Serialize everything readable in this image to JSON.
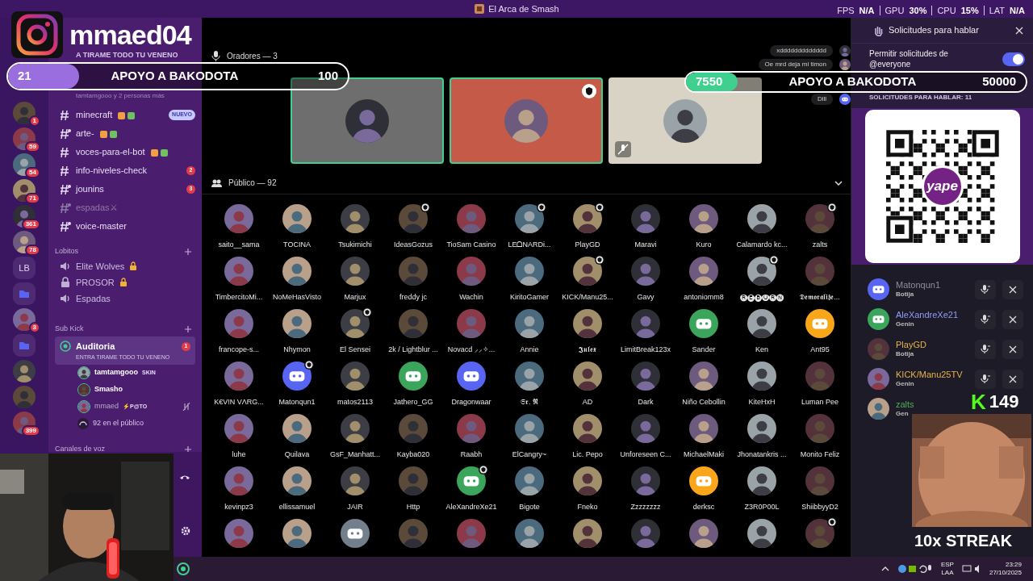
{
  "window": {
    "title": "El Arca de Smash"
  },
  "perf": [
    {
      "label": "FPS",
      "value": "N/A"
    },
    {
      "label": "GPU",
      "value": "30%"
    },
    {
      "label": "CPU",
      "value": "15%"
    },
    {
      "label": "LAT",
      "value": "N/A"
    }
  ],
  "servers": [
    {
      "kind": "picture",
      "badge": "1"
    },
    {
      "kind": "picture",
      "badge": "59"
    },
    {
      "kind": "picture",
      "badge": "54"
    },
    {
      "kind": "picture",
      "badge": "71"
    },
    {
      "kind": "picture",
      "badge": "361"
    },
    {
      "kind": "picture",
      "badge": "78"
    },
    {
      "kind": "initials",
      "text": "LB"
    },
    {
      "kind": "folder"
    },
    {
      "kind": "picture",
      "badge": "3"
    },
    {
      "kind": "folder"
    },
    {
      "kind": "picture"
    },
    {
      "kind": "picture"
    },
    {
      "kind": "picture",
      "badge": "399"
    }
  ],
  "channel_header": {
    "topic": "A TIRAME TODO TU VENENO",
    "listeners": "tamtamgooo y 2 personas más"
  },
  "channels": [
    {
      "name": "minecraft",
      "kind": "text",
      "muted": false,
      "tag": "NUEVO",
      "emoji": true
    },
    {
      "name": "arte-",
      "kind": "thread",
      "muted": false,
      "emoji": true
    },
    {
      "name": "voces-para-el-bot",
      "kind": "text",
      "muted": false,
      "emoji": true
    },
    {
      "name": "info-niveles-check",
      "kind": "text",
      "muted": false,
      "badge": "2"
    },
    {
      "name": "jounins",
      "kind": "thread",
      "muted": false,
      "badge": "3"
    },
    {
      "name": "espadas⚔",
      "kind": "thread",
      "muted": true
    },
    {
      "name": "voice-master",
      "kind": "thread",
      "muted": false
    }
  ],
  "categories": [
    {
      "name": "Lobitos",
      "channels": [
        {
          "name": "Elite Wolves",
          "kind": "voice",
          "locked": true
        },
        {
          "name": "PROSOR",
          "kind": "locked",
          "locked": true
        },
        {
          "name": "Espadas",
          "kind": "voice",
          "locked": false
        }
      ]
    },
    {
      "name": "Sub Kick",
      "channels": [
        {
          "name": "Auditoria",
          "kind": "stage",
          "locked": false,
          "badge": "1",
          "topic": "ENTRA TIRAME TODO TU VENENO",
          "members": [
            {
              "name": "tamtamgooo",
              "tag": "SKIN",
              "muted": false
            },
            {
              "name": "Smasho",
              "muted": false
            },
            {
              "name": "mmaed",
              "tag": "⚡P@TO",
              "muted": true
            }
          ],
          "audience": "92 en el público"
        }
      ]
    },
    {
      "name": "Canales de voz"
    }
  ],
  "stage": {
    "title": "Oradores — 3",
    "speakers": [
      {
        "color": "#6e6e6e",
        "speaking": true,
        "moderator": false,
        "muted": false
      },
      {
        "color": "#c65a48",
        "speaking": true,
        "moderator": true,
        "muted": false
      },
      {
        "color": "#d8d3c4",
        "speaking": false,
        "moderator": false,
        "muted": true
      }
    ]
  },
  "chat_bubbles": [
    {
      "text": "xddddddddddddd",
      "kind": "picture"
    },
    {
      "text": "Oe mrd deja mi timon",
      "kind": "picture"
    },
    {
      "text": "Dlll",
      "kind": "discord"
    }
  ],
  "audience": {
    "title": "Público — 92",
    "members": [
      {
        "name": "saito__sama",
        "kind": "picture",
        "badge": false
      },
      {
        "name": "TOCINA",
        "kind": "picture",
        "badge": false
      },
      {
        "name": "Tsukimichi",
        "kind": "picture",
        "badge": false
      },
      {
        "name": "IdeasGozus",
        "kind": "picture",
        "badge": true
      },
      {
        "name": "TioSam Casino",
        "kind": "picture",
        "badge": false
      },
      {
        "name": "LEᗝNARDi...",
        "kind": "picture",
        "badge": true
      },
      {
        "name": "PlayGD",
        "kind": "picture",
        "badge": true
      },
      {
        "name": "Maravi",
        "kind": "picture",
        "badge": false
      },
      {
        "name": "Kuro",
        "kind": "picture",
        "badge": false
      },
      {
        "name": "Calamardo kc...",
        "kind": "picture",
        "badge": false
      },
      {
        "name": "zalts",
        "kind": "picture",
        "badge": true
      },
      {
        "name": "TimbercitoMi...",
        "kind": "picture",
        "badge": false
      },
      {
        "name": "NoMeHasVisto",
        "kind": "picture",
        "badge": false
      },
      {
        "name": "Marjux",
        "kind": "picture",
        "badge": false
      },
      {
        "name": "freddy jc",
        "kind": "picture",
        "badge": false
      },
      {
        "name": "Wachin",
        "kind": "picture",
        "badge": false
      },
      {
        "name": "KiritoGamer",
        "kind": "picture",
        "badge": false
      },
      {
        "name": "KICK/Manu25...",
        "kind": "picture",
        "badge": true
      },
      {
        "name": "Gavy",
        "kind": "picture",
        "badge": false
      },
      {
        "name": "antoniomm8",
        "kind": "picture",
        "badge": false
      },
      {
        "name": "🅡🅔🅑🅞🅡🅝",
        "kind": "picture",
        "badge": true
      },
      {
        "name": "𝕯𝖊𝖒𝖔𝖗𝖆𝖑𝖎𝖟𝖊...",
        "kind": "picture",
        "badge": false
      },
      {
        "name": "francope-s...",
        "kind": "picture",
        "badge": false
      },
      {
        "name": "Nhymon",
        "kind": "picture",
        "badge": false
      },
      {
        "name": "El Sensei",
        "kind": "picture",
        "badge": true
      },
      {
        "name": "2k / Lightblur ...",
        "kind": "picture",
        "badge": false
      },
      {
        "name": "Novacd ⸝⸝✧...",
        "kind": "picture",
        "badge": false
      },
      {
        "name": "Annie",
        "kind": "picture",
        "badge": false
      },
      {
        "name": "𝕵𝖚𝖑𝖊𝖝",
        "kind": "picture",
        "badge": false
      },
      {
        "name": "LimitBreak123x",
        "kind": "picture",
        "badge": false
      },
      {
        "name": "Sander",
        "kind": "discord",
        "color": "#3ba55c",
        "badge": false
      },
      {
        "name": "Ken",
        "kind": "picture",
        "badge": false
      },
      {
        "name": "Ant95",
        "kind": "discord",
        "color": "#faa61a",
        "badge": false
      },
      {
        "name": "K€V!N VΛRG...",
        "kind": "picture",
        "badge": false
      },
      {
        "name": "Matonqun1",
        "kind": "discord",
        "color": "#5865f2",
        "badge": true
      },
      {
        "name": "matos2113",
        "kind": "picture",
        "badge": false
      },
      {
        "name": "Jathero_GG",
        "kind": "discord",
        "color": "#3ba55c",
        "badge": false
      },
      {
        "name": "Dragonwaar",
        "kind": "discord",
        "color": "#5865f2",
        "badge": false
      },
      {
        "name": "𝕾𝖗. 𝕽",
        "kind": "picture",
        "badge": false
      },
      {
        "name": "AD",
        "kind": "picture",
        "badge": false
      },
      {
        "name": "Dark",
        "kind": "picture",
        "badge": false
      },
      {
        "name": "Niño Cebollin",
        "kind": "picture",
        "badge": false
      },
      {
        "name": "KiteHxH",
        "kind": "picture",
        "badge": false
      },
      {
        "name": "Luman Pee",
        "kind": "picture",
        "badge": false
      },
      {
        "name": "luhe",
        "kind": "picture",
        "badge": false
      },
      {
        "name": "Quilava",
        "kind": "picture",
        "badge": false
      },
      {
        "name": "GsF_Manhatt...",
        "kind": "picture",
        "badge": false
      },
      {
        "name": "Kayba020",
        "kind": "picture",
        "badge": false
      },
      {
        "name": "Raabh",
        "kind": "picture",
        "badge": false
      },
      {
        "name": "ElCangry~",
        "kind": "picture",
        "badge": false
      },
      {
        "name": "Lic. Pepo",
        "kind": "picture",
        "badge": false
      },
      {
        "name": "Unforeseen C...",
        "kind": "picture",
        "badge": false
      },
      {
        "name": "MichaelMaki",
        "kind": "picture",
        "badge": false
      },
      {
        "name": "Jhonatankris ...",
        "kind": "picture",
        "badge": false
      },
      {
        "name": "Monito Feliz",
        "kind": "picture",
        "badge": false
      },
      {
        "name": "kevinpz3",
        "kind": "picture",
        "badge": false
      },
      {
        "name": "ellissamuel",
        "kind": "picture",
        "badge": false
      },
      {
        "name": "JAIR",
        "kind": "picture",
        "badge": false
      },
      {
        "name": "Http",
        "kind": "picture",
        "badge": false
      },
      {
        "name": "AleXandreXe21",
        "kind": "discord",
        "color": "#3ba55c",
        "badge": true
      },
      {
        "name": "Bigote",
        "kind": "picture",
        "badge": false
      },
      {
        "name": "Fneko",
        "kind": "picture",
        "badge": false
      },
      {
        "name": "Zzzzzzzz",
        "kind": "picture",
        "badge": false
      },
      {
        "name": "derksc",
        "kind": "discord",
        "color": "#faa61a",
        "badge": false
      },
      {
        "name": "Z3R0P00L",
        "kind": "picture",
        "badge": false
      },
      {
        "name": "ShiibbyyD2",
        "kind": "picture",
        "badge": false
      },
      {
        "kind": "picture",
        "badge": false
      },
      {
        "kind": "picture",
        "badge": false
      },
      {
        "kind": "discord",
        "color": "#747f8d",
        "badge": false
      },
      {
        "kind": "picture",
        "badge": false
      },
      {
        "kind": "picture",
        "badge": false
      },
      {
        "kind": "picture",
        "badge": false
      },
      {
        "kind": "picture",
        "badge": false
      },
      {
        "kind": "picture",
        "badge": false
      },
      {
        "kind": "picture",
        "badge": false
      },
      {
        "kind": "picture",
        "badge": false
      },
      {
        "kind": "picture",
        "badge": true
      }
    ]
  },
  "requests_panel": {
    "title": "Solicitudes para hablar",
    "toggle": {
      "label": "Permitir solicitudes de @everyone",
      "on": true
    },
    "count_label": "SOLICITUDES PARA HABLAR: 11",
    "qr_logo": "yape",
    "requests": [
      {
        "name": "Matonqun1",
        "role": "Botija",
        "color": "#8e8e99",
        "kind": "discord-blue"
      },
      {
        "name": "AleXandreXe21",
        "role": "Genin",
        "color": "#8f9cf5",
        "kind": "discord-green"
      },
      {
        "name": "PlayGD",
        "role": "Botija",
        "color": "#e6b34a",
        "kind": "picture"
      },
      {
        "name": "KICK/Manu25TV",
        "role": "Genin",
        "color": "#e6b34a",
        "kind": "picture"
      },
      {
        "name": "zalts",
        "role": "Gen",
        "color": "#4caf50",
        "kind": "picture"
      }
    ]
  },
  "overlays": {
    "instagram": {
      "handle": "mmaed04"
    },
    "goals": [
      {
        "current": "21",
        "title": "APOYO A BAKODOTA",
        "target": "100",
        "level": 0.21,
        "color": "#9b6ee0"
      },
      {
        "current": "7550",
        "title": "APOYO A BAKODOTA",
        "target": "50000",
        "level": 0.151,
        "color": "#3fcf8e"
      }
    ],
    "kick": {
      "logo": "K",
      "count": "149"
    },
    "streak": "10x STREAK"
  },
  "taskbar": {
    "language": "ESP",
    "layout": "LAA",
    "time": "23:29",
    "date": "27/10/2025"
  }
}
